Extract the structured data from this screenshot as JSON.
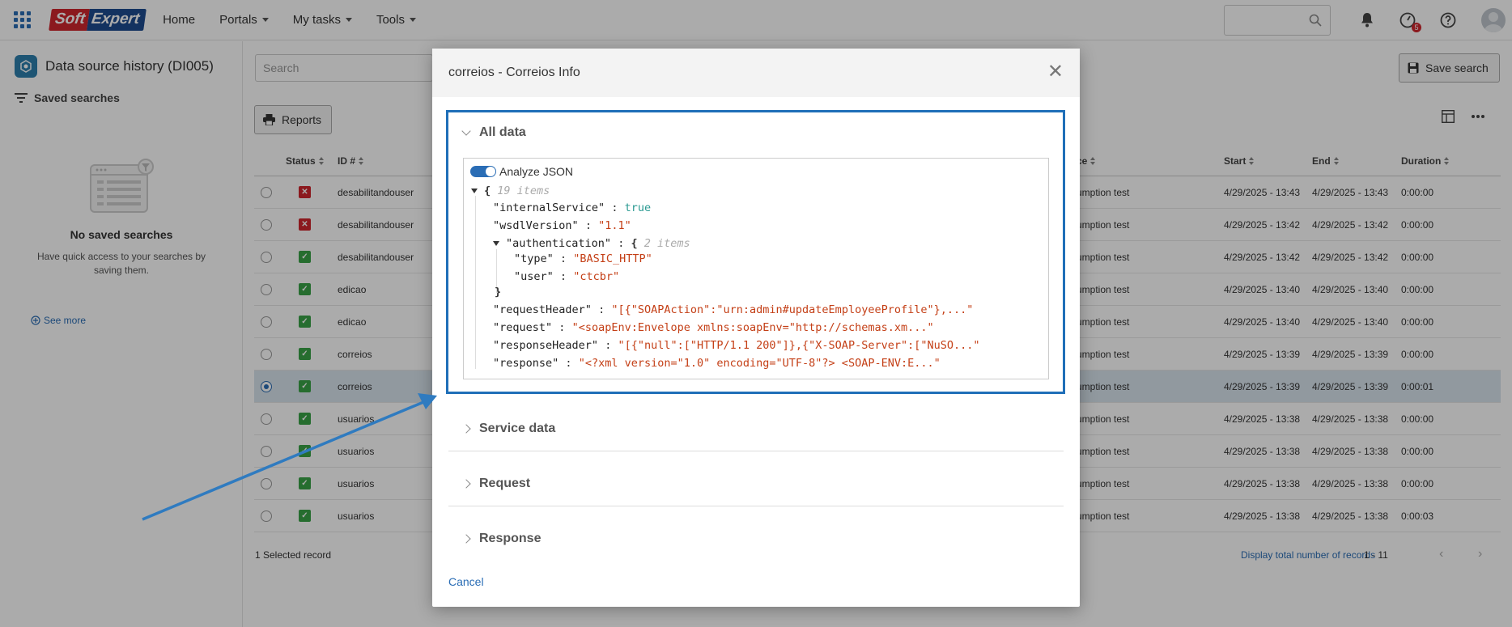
{
  "topbar": {
    "logo_soft": "Soft",
    "logo_expert": "Expert",
    "nav": [
      {
        "label": "Home",
        "caret": false
      },
      {
        "label": "Portals",
        "caret": true
      },
      {
        "label": "My tasks",
        "caret": true
      },
      {
        "label": "Tools",
        "caret": true
      }
    ],
    "tasks_badge": "5"
  },
  "sidebar": {
    "title": "Data source history (DI005)",
    "saved_searches": "Saved searches",
    "empty_title": "No saved searches",
    "empty_desc": "Have quick access to your searches by saving them.",
    "see_more": "See more"
  },
  "main": {
    "search_placeholder": "Search",
    "save_search": "Save search",
    "reports": "Reports",
    "columns": {
      "status": "Status",
      "id": "ID #",
      "source": "ce",
      "start": "Start",
      "end": "End",
      "duration": "Duration"
    },
    "rows": [
      {
        "status": "err",
        "id": "desabilitandouser",
        "source": "umption test",
        "start": "4/29/2025 - 13:43",
        "end": "4/29/2025 - 13:43",
        "duration": "0:00:00",
        "selected": false
      },
      {
        "status": "err",
        "id": "desabilitandouser",
        "source": "umption test",
        "start": "4/29/2025 - 13:42",
        "end": "4/29/2025 - 13:42",
        "duration": "0:00:00",
        "selected": false
      },
      {
        "status": "ok",
        "id": "desabilitandouser",
        "source": "umption test",
        "start": "4/29/2025 - 13:42",
        "end": "4/29/2025 - 13:42",
        "duration": "0:00:00",
        "selected": false
      },
      {
        "status": "ok",
        "id": "edicao",
        "source": "umption test",
        "start": "4/29/2025 - 13:40",
        "end": "4/29/2025 - 13:40",
        "duration": "0:00:00",
        "selected": false
      },
      {
        "status": "ok",
        "id": "edicao",
        "source": "umption test",
        "start": "4/29/2025 - 13:40",
        "end": "4/29/2025 - 13:40",
        "duration": "0:00:00",
        "selected": false
      },
      {
        "status": "ok",
        "id": "correios",
        "source": "umption test",
        "start": "4/29/2025 - 13:39",
        "end": "4/29/2025 - 13:39",
        "duration": "0:00:00",
        "selected": false
      },
      {
        "status": "ok",
        "id": "correios",
        "source": "umption test",
        "start": "4/29/2025 - 13:39",
        "end": "4/29/2025 - 13:39",
        "duration": "0:00:01",
        "selected": true
      },
      {
        "status": "ok",
        "id": "usuarios",
        "source": "umption test",
        "start": "4/29/2025 - 13:38",
        "end": "4/29/2025 - 13:38",
        "duration": "0:00:00",
        "selected": false
      },
      {
        "status": "ok",
        "id": "usuarios",
        "source": "umption test",
        "start": "4/29/2025 - 13:38",
        "end": "4/29/2025 - 13:38",
        "duration": "0:00:00",
        "selected": false
      },
      {
        "status": "ok",
        "id": "usuarios",
        "source": "umption test",
        "start": "4/29/2025 - 13:38",
        "end": "4/29/2025 - 13:38",
        "duration": "0:00:00",
        "selected": false
      },
      {
        "status": "ok",
        "id": "usuarios",
        "source": "umption test",
        "start": "4/29/2025 - 13:38",
        "end": "4/29/2025 - 13:38",
        "duration": "0:00:03",
        "selected": false
      }
    ],
    "selected_count": "1 Selected record",
    "display_total": "Display total number of records",
    "pages": "1 - 11"
  },
  "modal": {
    "title": "correios - Correios Info",
    "close": "✕",
    "sections": {
      "all_data": "All data",
      "service_data": "Service data",
      "request": "Request",
      "response": "Response"
    },
    "analyze_json": "Analyze JSON",
    "json": {
      "root_open": "{",
      "root_count": "19 items",
      "l1_key": "\"internalService\"",
      "l1_val": "true",
      "l2_key": "\"wsdlVersion\"",
      "l2_val": "\"1.1\"",
      "l3_key": "\"authentication\"",
      "l3_open": "{",
      "l3_count": "2 items",
      "l3a_key": "\"type\"",
      "l3a_val": "\"BASIC_HTTP\"",
      "l3b_key": "\"user\"",
      "l3b_val": "\"ctcbr\"",
      "l3_close": "}",
      "l4_key": "\"requestHeader\"",
      "l4_val": "\"[{\"SOAPAction\":\"urn:admin#updateEmployeeProfile\"},...\"",
      "l5_key": "\"request\"",
      "l5_val": "\"<soapEnv:Envelope xmlns:soapEnv=\"http://schemas.xm...\"",
      "l6_key": "\"responseHeader\"",
      "l6_val": "\"[{\"null\":[\"HTTP/1.1 200\"]},{\"X-SOAP-Server\":[\"NuSO...\"",
      "l7_key": "\"response\"",
      "l7_val": "\"<?xml version=\"1.0\" encoding=\"UTF-8\"?> <SOAP-ENV:E...\"",
      "colon": ":"
    },
    "cancel": "Cancel"
  },
  "colors": {
    "accent": "#1f6fb8",
    "brand_red": "#d0262d",
    "brand_blue": "#1d4b8f",
    "ok": "#3aa347"
  }
}
